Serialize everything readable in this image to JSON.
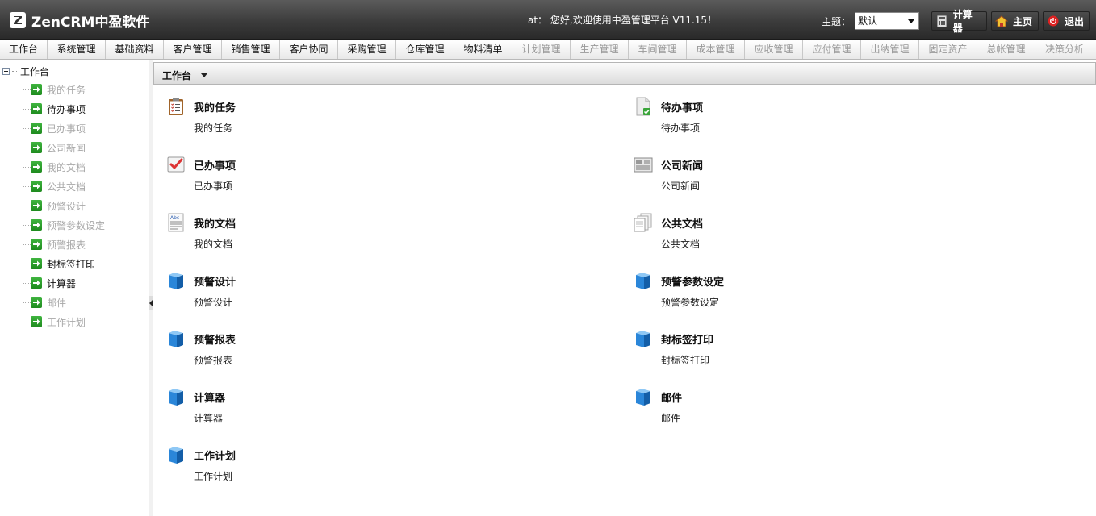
{
  "header": {
    "logo_text": "ZenCRM中盈軟件",
    "welcome": "at： 您好,欢迎使用中盈管理平台 V11.15！",
    "theme_label": "主题：",
    "theme_value": "默认",
    "buttons": [
      {
        "label": "计算器",
        "icon": "calculator-icon"
      },
      {
        "label": "主页",
        "icon": "home-icon"
      },
      {
        "label": "退出",
        "icon": "power-icon"
      }
    ]
  },
  "menu": [
    {
      "label": "工作台",
      "enabled": true
    },
    {
      "label": "系统管理",
      "enabled": true
    },
    {
      "label": "基础资料",
      "enabled": true
    },
    {
      "label": "客户管理",
      "enabled": true
    },
    {
      "label": "销售管理",
      "enabled": true
    },
    {
      "label": "客户协同",
      "enabled": true
    },
    {
      "label": "采购管理",
      "enabled": true
    },
    {
      "label": "仓库管理",
      "enabled": true
    },
    {
      "label": "物料清单",
      "enabled": true
    },
    {
      "label": "计划管理",
      "enabled": false
    },
    {
      "label": "生产管理",
      "enabled": false
    },
    {
      "label": "车间管理",
      "enabled": false
    },
    {
      "label": "成本管理",
      "enabled": false
    },
    {
      "label": "应收管理",
      "enabled": false
    },
    {
      "label": "应付管理",
      "enabled": false
    },
    {
      "label": "出纳管理",
      "enabled": false
    },
    {
      "label": "固定资产",
      "enabled": false
    },
    {
      "label": "总帐管理",
      "enabled": false
    },
    {
      "label": "决策分析",
      "enabled": false
    }
  ],
  "sidebar": {
    "root_label": "工作台",
    "items": [
      {
        "label": "我的任务",
        "enabled": false
      },
      {
        "label": "待办事项",
        "enabled": true
      },
      {
        "label": "已办事项",
        "enabled": false
      },
      {
        "label": "公司新闻",
        "enabled": false
      },
      {
        "label": "我的文档",
        "enabled": false
      },
      {
        "label": "公共文档",
        "enabled": false
      },
      {
        "label": "预警设计",
        "enabled": false
      },
      {
        "label": "预警参数设定",
        "enabled": false
      },
      {
        "label": "预警报表",
        "enabled": false
      },
      {
        "label": "封标签打印",
        "enabled": true
      },
      {
        "label": "计算器",
        "enabled": true
      },
      {
        "label": "邮件",
        "enabled": false
      },
      {
        "label": "工作计划",
        "enabled": false
      }
    ]
  },
  "main": {
    "panel_title": "工作台",
    "entries": [
      {
        "title": "我的任务",
        "desc": "我的任务",
        "icon": "clipboard-icon"
      },
      {
        "title": "待办事项",
        "desc": "待办事项",
        "icon": "todo-document-icon"
      },
      {
        "title": "已办事项",
        "desc": "已办事项",
        "icon": "checkmark-icon"
      },
      {
        "title": "公司新闻",
        "desc": "公司新闻",
        "icon": "newspaper-icon"
      },
      {
        "title": "我的文档",
        "desc": "我的文档",
        "icon": "text-document-icon"
      },
      {
        "title": "公共文档",
        "desc": "公共文档",
        "icon": "documents-icon"
      },
      {
        "title": "预警设计",
        "desc": "预警设计",
        "icon": "blue-cube-icon"
      },
      {
        "title": "预警参数设定",
        "desc": "预警参数设定",
        "icon": "blue-cube-icon"
      },
      {
        "title": "预警报表",
        "desc": "预警报表",
        "icon": "blue-cube-icon"
      },
      {
        "title": "封标签打印",
        "desc": "封标签打印",
        "icon": "blue-cube-icon"
      },
      {
        "title": "计算器",
        "desc": "计算器",
        "icon": "blue-cube-icon"
      },
      {
        "title": "邮件",
        "desc": "邮件",
        "icon": "blue-cube-icon"
      },
      {
        "title": "工作计划",
        "desc": "工作计划",
        "icon": "blue-cube-icon"
      }
    ]
  }
}
